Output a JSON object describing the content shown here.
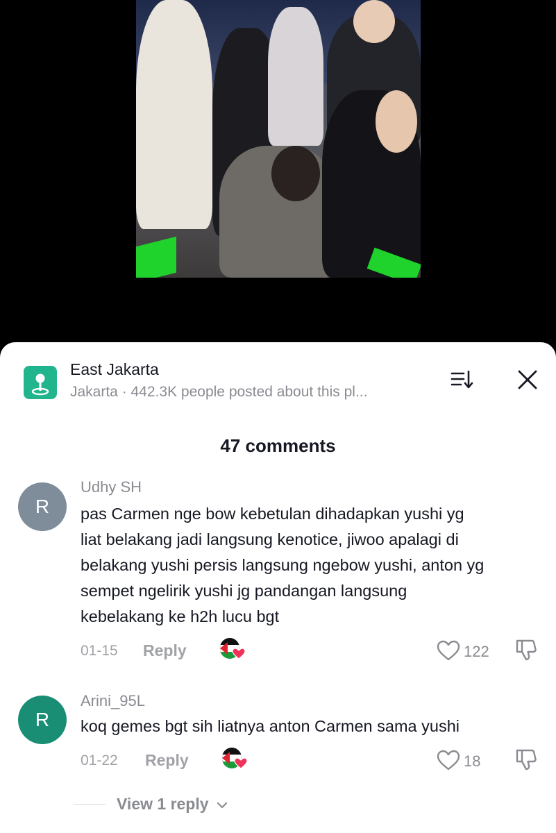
{
  "location": {
    "title": "East Jakarta",
    "subtitle": "Jakarta · 442.3K people posted about this pl..."
  },
  "comments_header": {
    "count_label": "47 comments"
  },
  "comments": [
    {
      "avatar_letter": "R",
      "avatar_color": "#7f8c9a",
      "username": "Udhy SH",
      "lines": [
        "pas Carmen nge bow kebetulan dihadapkan yushi yg",
        "liat belakang jadi langsung kenotice, jiwoo apalagi di",
        "belakang yushi persis langsung ngebow yushi, anton yg",
        "sempet ngelirik yushi jg pandangan langsung",
        "kebelakang ke h2h lucu bgt"
      ],
      "date": "01-15",
      "reply_label": "Reply",
      "likes": "122"
    },
    {
      "avatar_letter": "R",
      "avatar_color": "#1a8e74",
      "username": "Arini_95L",
      "lines": [
        "koq gemes bgt sih liatnya anton Carmen sama yushi"
      ],
      "date": "01-22",
      "reply_label": "Reply",
      "likes": "18"
    }
  ],
  "view_replies": {
    "label": "View 1 reply",
    "chevron": "chevron-down-icon"
  },
  "icons": {
    "location": "map-pin-icon",
    "sort": "sort-icon",
    "close": "close-icon",
    "like": "heart-outline-icon",
    "dislike": "thumbs-down-icon",
    "sticker": "palestine-flag-heart-sticker"
  },
  "colors": {
    "accent_location": "#21b58d",
    "text_primary": "#161823",
    "text_secondary": "#8a8b91"
  }
}
